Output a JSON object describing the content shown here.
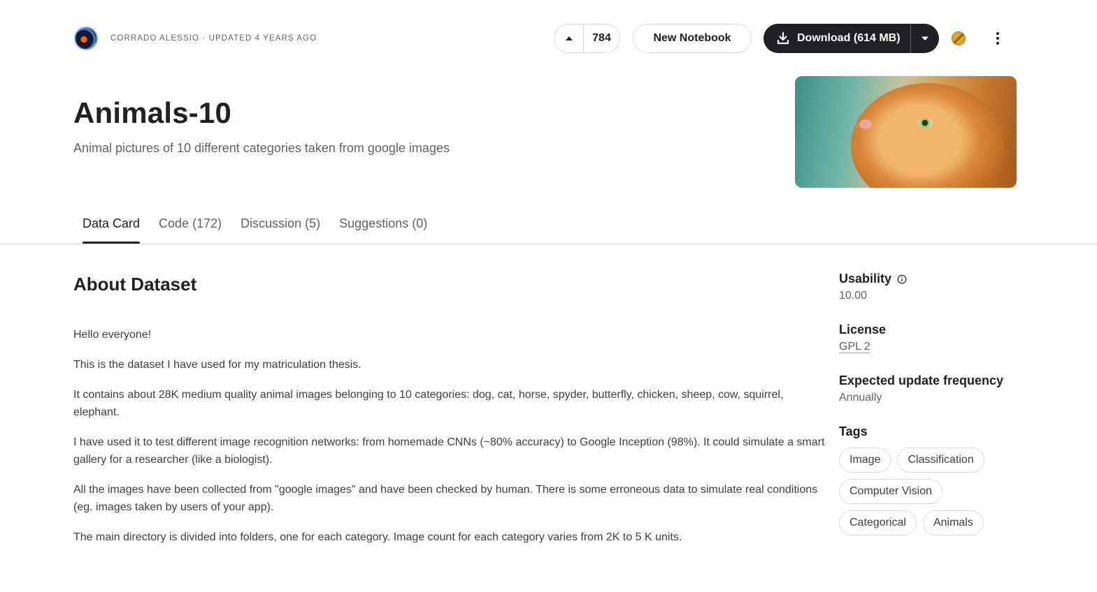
{
  "header": {
    "owner_line": "CORRADO ALESSIO · UPDATED 4 YEARS AGO",
    "upvotes": "784",
    "new_notebook_label": "New Notebook",
    "download_label": "Download (614 MB)"
  },
  "dataset": {
    "title": "Animals-10",
    "subtitle": "Animal pictures of 10 different categories taken from google images"
  },
  "tabs": [
    {
      "label": "Data Card",
      "active": true
    },
    {
      "label": "Code (172)",
      "active": false
    },
    {
      "label": "Discussion (5)",
      "active": false
    },
    {
      "label": "Suggestions (0)",
      "active": false
    }
  ],
  "about": {
    "heading": "About Dataset",
    "paragraphs": [
      "Hello everyone!",
      "This is the dataset I have used for my matriculation thesis.",
      "It contains about 28K medium quality animal images belonging to 10 categories: dog, cat, horse, spyder, butterfly, chicken, sheep, cow, squirrel, elephant.",
      "I have used it to test different image recognition networks: from homemade CNNs (~80% accuracy) to Google Inception (98%). It could simulate a smart gallery for a researcher (like a biologist).",
      "All the images have been collected from \"google images\" and have been checked by human. There is some erroneous data to simulate real conditions (eg. images taken by users of your app).",
      "The main directory is divided into folders, one for each category. Image count for each category varies from 2K to 5 K units."
    ]
  },
  "sidebar": {
    "usability_label": "Usability",
    "usability_value": "10.00",
    "license_label": "License",
    "license_value": "GPL 2",
    "frequency_label": "Expected update frequency",
    "frequency_value": "Annually",
    "tags_label": "Tags",
    "tags": [
      "Image",
      "Classification",
      "Computer Vision",
      "Categorical",
      "Animals"
    ]
  },
  "colors": {
    "primary_dark": "#202124",
    "muted_text": "#5f6368",
    "border": "#dadce0"
  }
}
